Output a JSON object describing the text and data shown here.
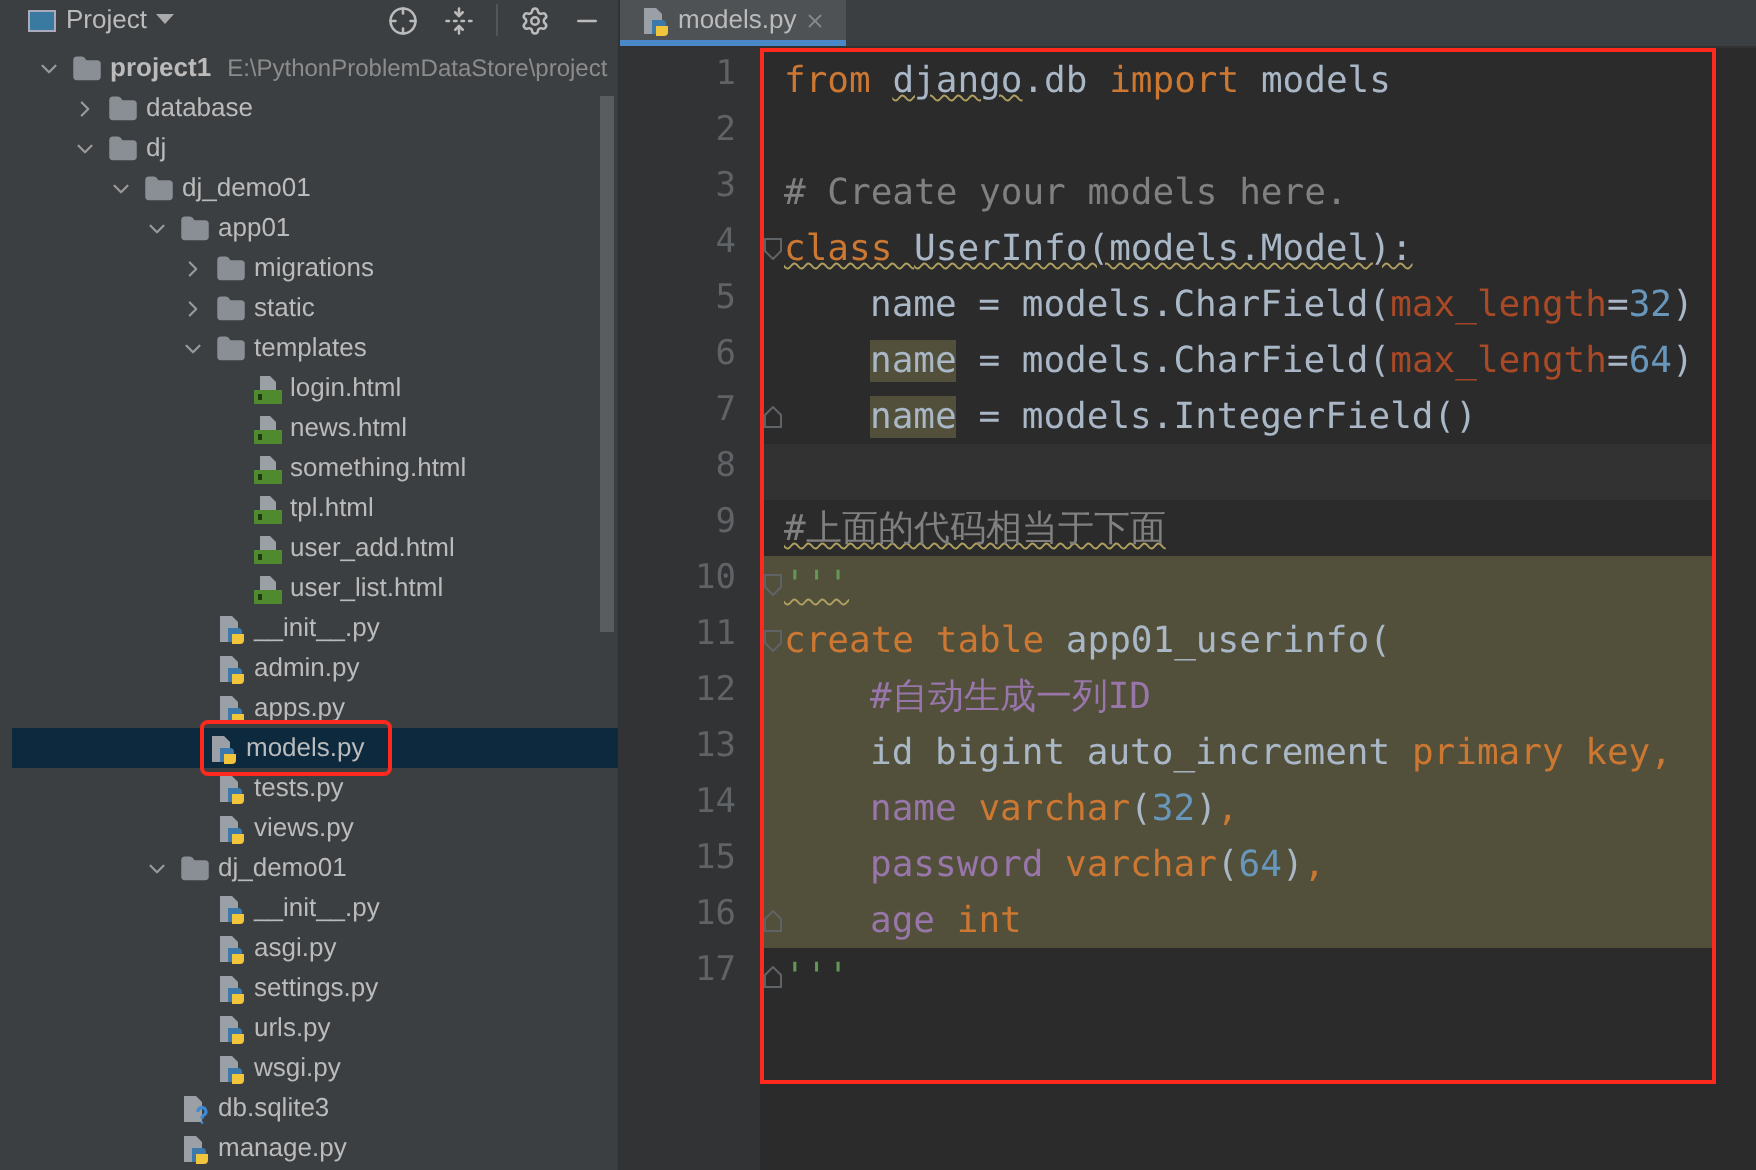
{
  "project_panel": {
    "title": "Project"
  },
  "tree": [
    {
      "name": "project1",
      "path": "E:\\PythonProblemDataStore\\project",
      "kind": "folder",
      "expanded": true,
      "selected": false,
      "children": [
        {
          "name": "database",
          "kind": "folder",
          "expanded": false,
          "selected": false
        },
        {
          "name": "dj",
          "kind": "folder",
          "expanded": true,
          "selected": false,
          "children": [
            {
              "name": "dj_demo01",
              "kind": "folder",
              "expanded": true,
              "selected": false,
              "children": [
                {
                  "name": "app01",
                  "kind": "folder",
                  "expanded": true,
                  "selected": false,
                  "children": [
                    {
                      "name": "migrations",
                      "kind": "folder",
                      "expanded": false,
                      "selected": false
                    },
                    {
                      "name": "static",
                      "kind": "folder",
                      "expanded": false,
                      "selected": false
                    },
                    {
                      "name": "templates",
                      "kind": "folder",
                      "expanded": true,
                      "selected": false,
                      "children": [
                        {
                          "name": "login.html",
                          "kind": "html",
                          "selected": false
                        },
                        {
                          "name": "news.html",
                          "kind": "html",
                          "selected": false
                        },
                        {
                          "name": "something.html",
                          "kind": "html",
                          "selected": false
                        },
                        {
                          "name": "tpl.html",
                          "kind": "html",
                          "selected": false
                        },
                        {
                          "name": "user_add.html",
                          "kind": "html",
                          "selected": false
                        },
                        {
                          "name": "user_list.html",
                          "kind": "html",
                          "selected": false
                        }
                      ]
                    },
                    {
                      "name": "__init__.py",
                      "kind": "python",
                      "selected": false
                    },
                    {
                      "name": "admin.py",
                      "kind": "python",
                      "selected": false
                    },
                    {
                      "name": "apps.py",
                      "kind": "python",
                      "selected": false
                    },
                    {
                      "name": "models.py",
                      "kind": "python",
                      "selected": true,
                      "annotated": true
                    },
                    {
                      "name": "tests.py",
                      "kind": "python",
                      "selected": false
                    },
                    {
                      "name": "views.py",
                      "kind": "python",
                      "selected": false
                    }
                  ]
                },
                {
                  "name": "dj_demo01",
                  "kind": "folder",
                  "expanded": true,
                  "selected": false,
                  "children": [
                    {
                      "name": "__init__.py",
                      "kind": "python",
                      "selected": false
                    },
                    {
                      "name": "asgi.py",
                      "kind": "python",
                      "selected": false
                    },
                    {
                      "name": "settings.py",
                      "kind": "python",
                      "selected": false
                    },
                    {
                      "name": "urls.py",
                      "kind": "python",
                      "selected": false
                    },
                    {
                      "name": "wsgi.py",
                      "kind": "python",
                      "selected": false
                    }
                  ]
                },
                {
                  "name": "db.sqlite3",
                  "kind": "unknown",
                  "selected": false
                },
                {
                  "name": "manage.py",
                  "kind": "python",
                  "selected": false
                }
              ]
            }
          ]
        }
      ]
    }
  ],
  "editor_tabs": [
    {
      "label": "models.py",
      "selected": true
    }
  ],
  "editor": {
    "annotated": true,
    "lines": [
      {
        "number": "1",
        "tokens": [
          {
            "text": "from ",
            "kind": "keyword"
          },
          {
            "text": "django",
            "kind": "plain",
            "squiggle": true
          },
          {
            "text": ".db ",
            "kind": "plain"
          },
          {
            "text": "import ",
            "kind": "keyword"
          },
          {
            "text": "models",
            "kind": "plain"
          }
        ]
      },
      {
        "number": "2"
      },
      {
        "number": "3",
        "tokens": [
          {
            "text": "# Create your models here.",
            "kind": "comment"
          }
        ]
      },
      {
        "number": "4",
        "fold_start": true,
        "tokens": [
          {
            "text": "class ",
            "kind": "keyword",
            "squiggle": true
          },
          {
            "text": "UserInfo(models.Model):",
            "kind": "plain",
            "squiggle": true
          }
        ]
      },
      {
        "number": "5",
        "indented": true,
        "tokens": [
          {
            "text": "name = models.CharField(",
            "kind": "plain"
          },
          {
            "text": "max_length",
            "kind": "kwarg"
          },
          {
            "text": "=",
            "kind": "plain"
          },
          {
            "text": "32",
            "kind": "number"
          },
          {
            "text": ")",
            "kind": "plain"
          }
        ]
      },
      {
        "number": "6",
        "indented": true,
        "tokens": [
          {
            "text": "name",
            "kind": "usage"
          },
          {
            "text": " = models.CharField(",
            "kind": "plain"
          },
          {
            "text": "max_length",
            "kind": "kwarg"
          },
          {
            "text": "=",
            "kind": "plain"
          },
          {
            "text": "64",
            "kind": "number"
          },
          {
            "text": ")",
            "kind": "plain"
          }
        ]
      },
      {
        "number": "7",
        "indented": true,
        "fold_end": true,
        "tokens": [
          {
            "text": "name",
            "kind": "usage"
          },
          {
            "text": " = models.IntegerField()",
            "kind": "plain"
          }
        ]
      },
      {
        "number": "8",
        "caret_line": true
      },
      {
        "number": "9",
        "tokens": [
          {
            "text": "#上面的代码相当于下面",
            "kind": "comment",
            "squiggle": true
          }
        ]
      },
      {
        "number": "10",
        "highlighted": true,
        "fold_start": true,
        "tokens": [
          {
            "text": "'''",
            "kind": "string",
            "squiggle": true
          }
        ]
      },
      {
        "number": "11",
        "highlighted": true,
        "fold_start": true,
        "tokens": [
          {
            "text": "create ",
            "kind": "keyword"
          },
          {
            "text": "table ",
            "kind": "keyword"
          },
          {
            "text": "app01_userinfo(",
            "kind": "plain"
          }
        ]
      },
      {
        "number": "12",
        "highlighted": true,
        "indented": true,
        "tokens": [
          {
            "text": "#自动生成一列ID",
            "kind": "field"
          }
        ]
      },
      {
        "number": "13",
        "highlighted": true,
        "indented": true,
        "tokens": [
          {
            "text": "id bigint auto_increment ",
            "kind": "plain"
          },
          {
            "text": "primary key,",
            "kind": "keyword"
          }
        ]
      },
      {
        "number": "14",
        "highlighted": true,
        "indented": true,
        "tokens": [
          {
            "text": "name ",
            "kind": "field"
          },
          {
            "text": "varchar",
            "kind": "keyword"
          },
          {
            "text": "(",
            "kind": "plain"
          },
          {
            "text": "32",
            "kind": "number"
          },
          {
            "text": ")",
            "kind": "plain"
          },
          {
            "text": ",",
            "kind": "keyword"
          }
        ]
      },
      {
        "number": "15",
        "highlighted": true,
        "indented": true,
        "tokens": [
          {
            "text": "password ",
            "kind": "field"
          },
          {
            "text": "varchar",
            "kind": "keyword"
          },
          {
            "text": "(",
            "kind": "plain"
          },
          {
            "text": "64",
            "kind": "number"
          },
          {
            "text": ")",
            "kind": "plain"
          },
          {
            "text": ",",
            "kind": "keyword"
          }
        ]
      },
      {
        "number": "16",
        "highlighted": true,
        "indented": true,
        "fold_end": true,
        "tokens": [
          {
            "text": "age ",
            "kind": "field"
          },
          {
            "text": "int",
            "kind": "keyword"
          }
        ]
      },
      {
        "number": "17",
        "fold_end": true,
        "tokens": [
          {
            "text": "'''",
            "kind": "string"
          }
        ]
      }
    ]
  }
}
